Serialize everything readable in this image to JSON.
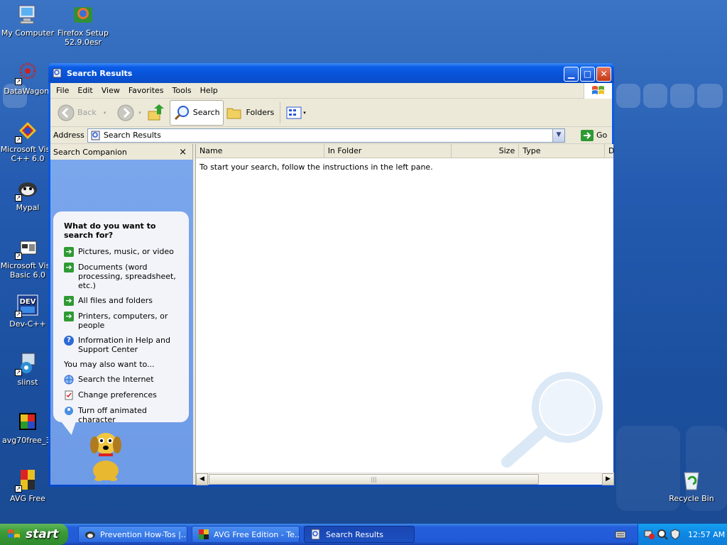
{
  "desktop": {
    "icons": [
      {
        "label": "My Computer"
      },
      {
        "label": "Firefox Setup 52.9.0esr"
      },
      {
        "label": "DataWagon."
      },
      {
        "label": "Microsoft Visu C++ 6.0"
      },
      {
        "label": "Mypal"
      },
      {
        "label": "Microsoft Visu Basic 6.0"
      },
      {
        "label": "Dev-C++"
      },
      {
        "label": "siinst"
      },
      {
        "label": "avg70free_3."
      },
      {
        "label": "AVG Free"
      },
      {
        "label": "Recycle Bin"
      }
    ]
  },
  "window": {
    "title": "Search Results",
    "menu": [
      "File",
      "Edit",
      "View",
      "Favorites",
      "Tools",
      "Help"
    ],
    "toolbar": {
      "back": "Back",
      "search": "Search",
      "folders": "Folders"
    },
    "address": {
      "label": "Address",
      "value": "Search Results",
      "go": "Go"
    },
    "companion": {
      "title": "Search Companion",
      "close": "×",
      "question": "What do you want to search for?",
      "options": [
        "Pictures, music, or video",
        "Documents (word processing, spreadsheet, etc.)",
        "All files and folders",
        "Printers, computers, or people",
        "Information in Help and Support Center"
      ],
      "also_label": "You may also want to...",
      "also": [
        "Search the Internet",
        "Change preferences",
        "Turn off animated character"
      ]
    },
    "columns": [
      "Name",
      "In Folder",
      "Size",
      "Type",
      "D"
    ],
    "message": "To start your search, follow the instructions in the left pane."
  },
  "taskbar": {
    "start": "start",
    "tasks": [
      "Prevention How-Tos |...",
      "AVG Free Edition - Te...",
      "Search Results"
    ],
    "clock": "12:57 AM"
  },
  "colors": {
    "title_blue": "#0a54e0",
    "pane_blue": "#6f9ee8",
    "taskbar": "#245edb",
    "start_green": "#3c9a37"
  }
}
